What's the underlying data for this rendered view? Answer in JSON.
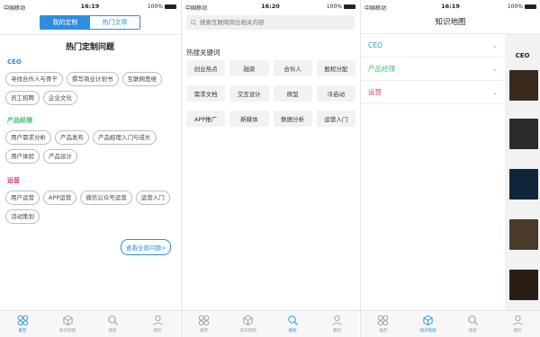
{
  "status": [
    {
      "carrier": "中国移动",
      "time": "16:19",
      "battery": "100%"
    },
    {
      "carrier": "中国移动",
      "time": "16:20",
      "battery": "100%"
    },
    {
      "carrier": "中国移动",
      "time": "16:19",
      "battery": "100%"
    }
  ],
  "screen1": {
    "seg_left": "我的定制",
    "seg_right": "热门文章",
    "title": "热门定制问题",
    "sections": [
      {
        "title": "CEO",
        "color": "#2f8de4",
        "tags": [
          "寻找合伙人与骨干",
          "撰写商业计划书",
          "互联网思维",
          "员工招聘",
          "企业文化"
        ]
      },
      {
        "title": "产品经理",
        "color": "#3cbf6f",
        "tags": [
          "用户需求分析",
          "产品发布",
          "产品经理入门与成长",
          "用户体验",
          "产品设计"
        ]
      },
      {
        "title": "运营",
        "color": "#e0407a",
        "tags": [
          "用户运营",
          "APP运营",
          "微信公众号运营",
          "运营入门",
          "活动策划"
        ]
      }
    ],
    "view_all": "查看全部问题>"
  },
  "screen2": {
    "search_placeholder": "搜索互联网岗位相关内容",
    "title": "热搜关键词",
    "keywords": [
      "创业热点",
      "融资",
      "合伙人",
      "股权分配",
      "需求文档",
      "交互设计",
      "原型",
      "冷启动",
      "APP推广",
      "新媒体",
      "数据分析",
      "运营入门"
    ]
  },
  "screen3": {
    "title": "知识地图",
    "items": [
      {
        "label": "CEO",
        "color": "#2f8de4"
      },
      {
        "label": "产品经理",
        "color": "#3cbf6f"
      },
      {
        "label": "运营",
        "color": "#e0407a"
      }
    ],
    "panel_label": "CEO"
  },
  "tabbar": [
    "推荐",
    "知识地图",
    "搜索",
    "我的"
  ],
  "active_tabs": [
    0,
    2,
    1
  ],
  "colors": {
    "accent": "#2f8de4",
    "green": "#3cbf6f",
    "pink": "#e0407a"
  }
}
